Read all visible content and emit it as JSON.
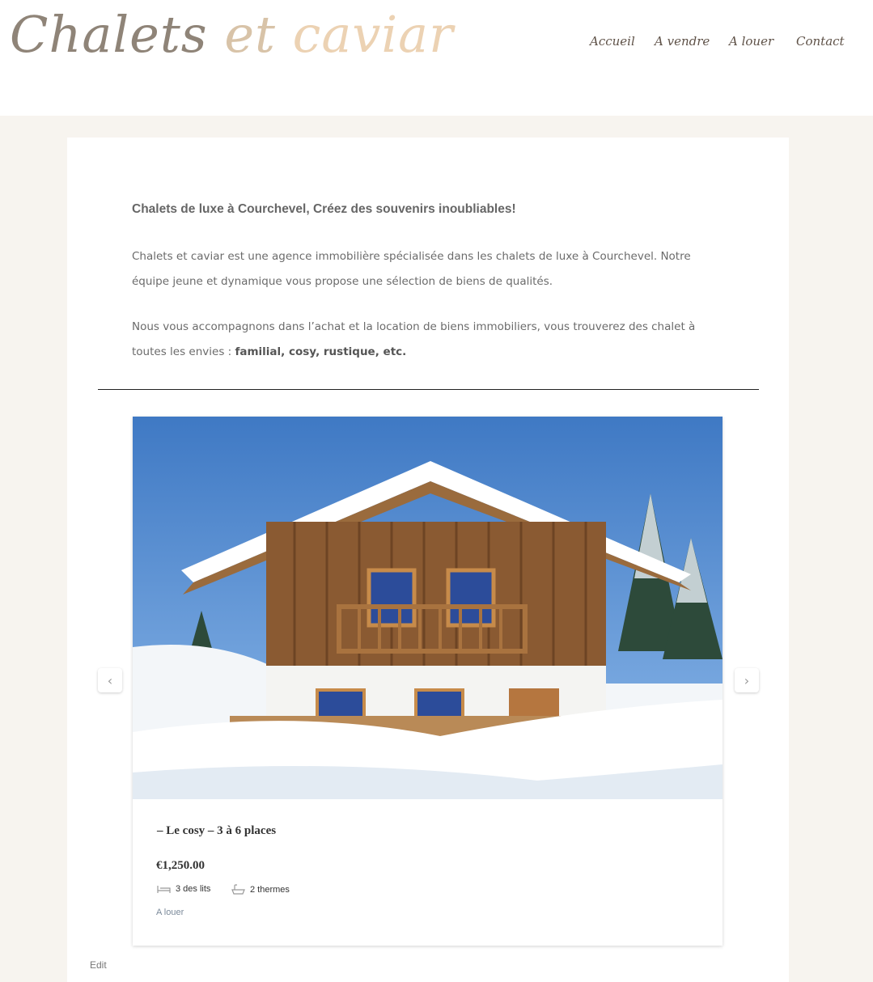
{
  "logo": {
    "word1": "Chalets",
    "word2": "et",
    "word3": "caviar"
  },
  "nav": {
    "items": [
      "Accueil",
      "A vendre",
      "A louer",
      "Contact"
    ]
  },
  "intro": {
    "headline": "Chalets de luxe à Courchevel, Créez des souvenirs inoubliables!",
    "paragraph1": "Chalets et caviar est une agence immobilière spécialisée dans les chalets de luxe à Courchevel. Notre équipe jeune et dynamique vous propose une sélection de biens de qualités.",
    "paragraph2_text": "Nous vous accompagnons dans  l’achat et la location de biens immobiliers, vous trouverez des chalet à toutes les envies : ",
    "paragraph2_bold": "familial, cosy, rustique, etc."
  },
  "listing": {
    "title": "– Le cosy – 3 à 6 places",
    "price": "€1,250.00",
    "beds": "3 des lits",
    "baths": "2 thermes",
    "status": "A louer"
  },
  "carousel": {
    "prev_icon": "chevron-left-icon",
    "next_icon": "chevron-right-icon"
  },
  "footer": {
    "edit_label": "Edit"
  },
  "colors": {
    "background": "#f7f4ef",
    "logo_dark": "#8f8478",
    "logo_light": "#ecd2b3",
    "nav": "#5f5248"
  }
}
